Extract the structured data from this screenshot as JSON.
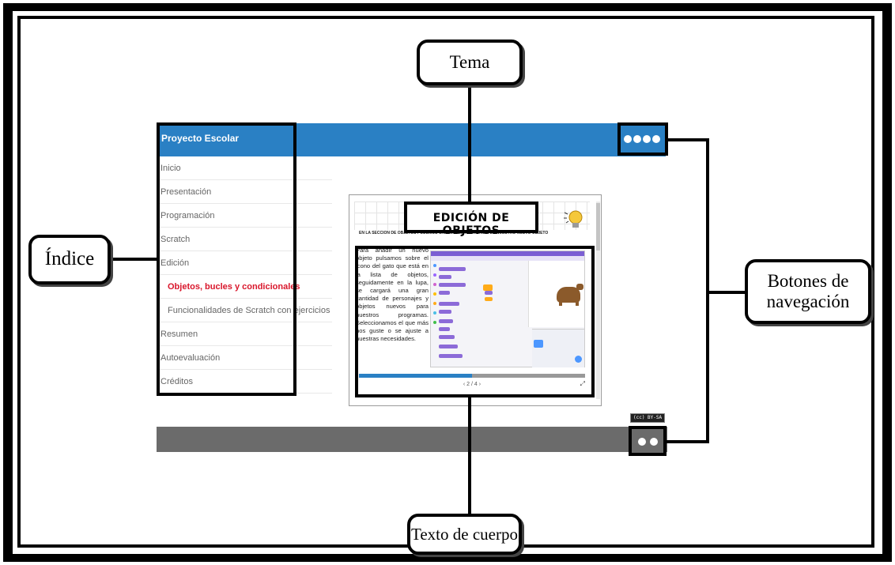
{
  "annotations": {
    "tema": "Tema",
    "indice": "Índice",
    "botones": "Botones de navegación",
    "texto_cuerpo": "Texto de cuerpo"
  },
  "app": {
    "title": "Proyecto Escolar"
  },
  "sidebar": {
    "items": [
      {
        "label": "Inicio",
        "level": 0,
        "active": false
      },
      {
        "label": "Presentación",
        "level": 0,
        "active": false
      },
      {
        "label": "Programación",
        "level": 0,
        "active": false
      },
      {
        "label": "Scratch",
        "level": 0,
        "active": false
      },
      {
        "label": "Edición",
        "level": 0,
        "active": false
      },
      {
        "label": "Objetos, bucles y condicionales",
        "level": 1,
        "active": true
      },
      {
        "label": "Funcionalidades de Scratch con ejercicios",
        "level": 1,
        "active": false
      },
      {
        "label": "Resumen",
        "level": 0,
        "active": false
      },
      {
        "label": "Autoevaluación",
        "level": 0,
        "active": false
      },
      {
        "label": "Créditos",
        "level": 0,
        "active": false
      }
    ]
  },
  "slide": {
    "title": "EDICIÓN DE OBJETOS",
    "subtitle": "EN LA SECCIÓN DE OBJETOS PODEMOS CAMBIAR LA APARIENCIA DE NUESTRO NUEVO OBJETO",
    "body": "Para añadir un nuevo objeto pulsamos sobre el icono del gato que está en la lista de objetos, seguidamente en la lupa, se cargará una gran cantidad de personajes y objetos nuevos para nuestros programas. Seleccionamos el que más nos guste o se ajuste a nuestras necesidades.",
    "pager": "‹ 2 / 4 ›",
    "progress": 0.5
  },
  "license": "(cc) BY-SA",
  "colors": {
    "topbar": "#2a80c4",
    "bottombar": "#6b6b6b",
    "active_link": "#d9162b"
  }
}
